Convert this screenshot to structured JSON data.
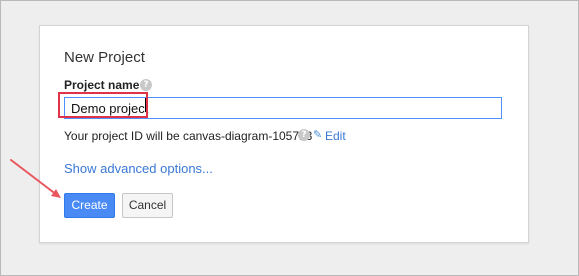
{
  "dialog": {
    "title": "New Project",
    "field_label": "Project name",
    "help_icon_glyph": "?",
    "name_value": "Demo project",
    "project_id_text": "Your project ID will be canvas-diagram-105713",
    "edit_icon_glyph": "✎",
    "edit_label": "Edit",
    "advanced_link": "Show advanced options...",
    "create_label": "Create",
    "cancel_label": "Cancel"
  },
  "annotations": {
    "highlight_color": "#e0334a",
    "arrow_color": "#e8585e"
  },
  "icons": [
    "help-icon",
    "edit-icon",
    "annotation-arrow"
  ],
  "colors": {
    "primary": "#4a8af4",
    "link": "#3a78d6",
    "background": "#eeeeee"
  }
}
